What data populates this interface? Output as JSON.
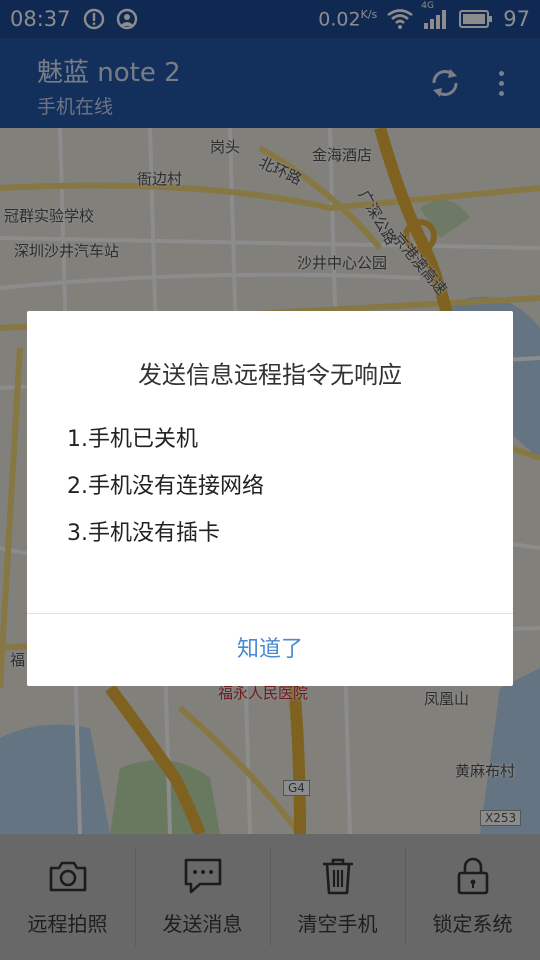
{
  "status_bar": {
    "time": "08:37",
    "net_speed": "0.02",
    "net_speed_unit": "K/s",
    "network_type": "4G",
    "battery": "97",
    "icons": [
      "alert-icon",
      "app-notification-icon",
      "wifi-icon",
      "signal-icon",
      "battery-icon"
    ]
  },
  "app_bar": {
    "title": "魅蓝 note 2",
    "subtitle": "手机在线",
    "actions": [
      "refresh-icon",
      "more-vert-icon"
    ]
  },
  "map": {
    "labels": [
      "岗头",
      "金海酒店",
      "衙边村",
      "北环路",
      "冠群实验学校",
      "深圳沙井汽车站",
      "沙井中心公园",
      "京港澳高速",
      "广深公路",
      "福",
      "福永人民医院",
      "凤凰山",
      "黄麻布村",
      "G4",
      "X253"
    ]
  },
  "dialog": {
    "title": "发送信息远程指令无响应",
    "items": [
      "1.手机已关机",
      "2.手机没有连接网络",
      "3.手机没有插卡"
    ],
    "confirm_label": "知道了"
  },
  "bottom_bar": {
    "items": [
      {
        "label": "远程拍照",
        "icon": "camera-icon"
      },
      {
        "label": "发送消息",
        "icon": "message-icon"
      },
      {
        "label": "清空手机",
        "icon": "trash-icon"
      },
      {
        "label": "锁定系统",
        "icon": "lock-icon"
      }
    ]
  },
  "colors": {
    "status_bar": "#1e4b97",
    "app_bar": "#2458a8",
    "dialog_button": "#4a8ad4",
    "bottom_bar": "#bdbdbd"
  }
}
